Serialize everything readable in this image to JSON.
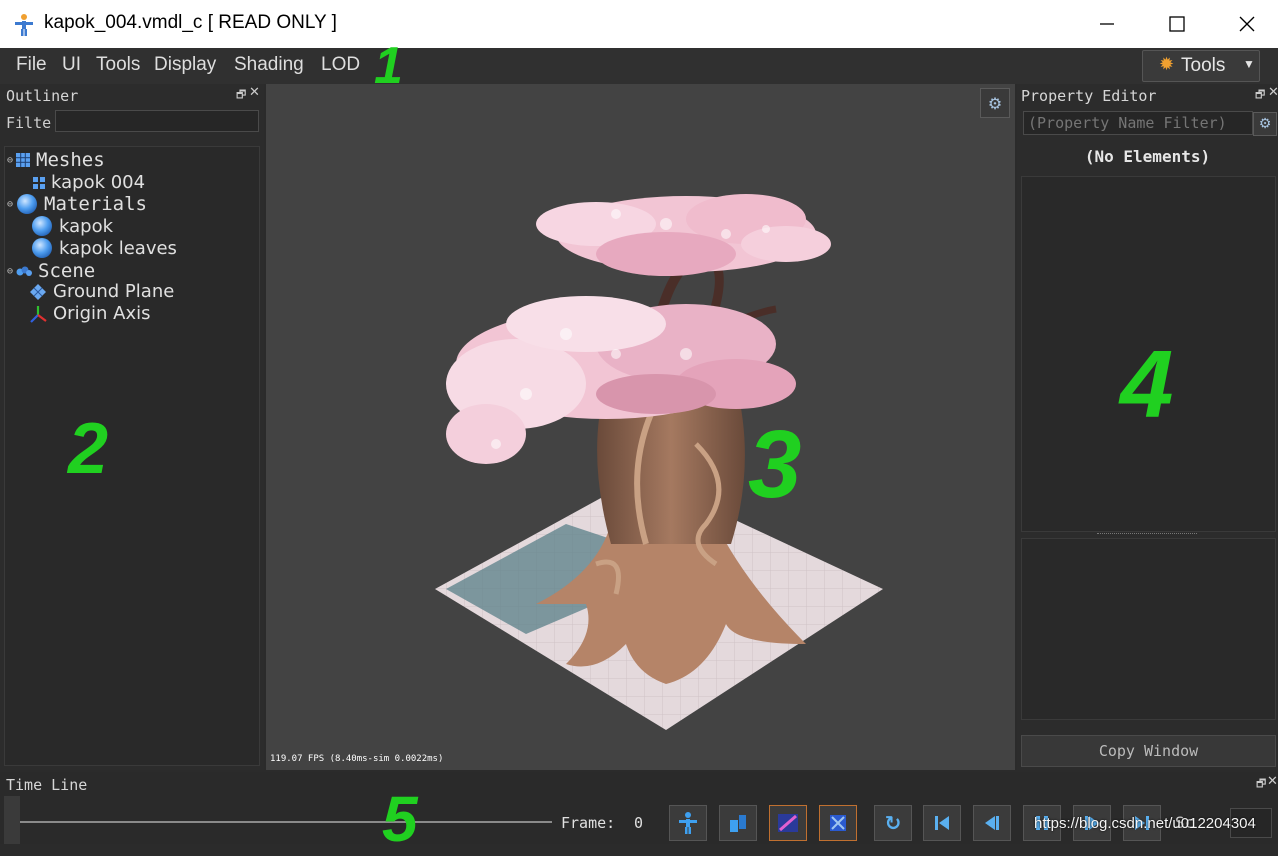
{
  "window": {
    "title": "kapok_004.vmdl_c [ READ ONLY ]",
    "minimize": "minimize-icon",
    "maximize": "maximize-icon",
    "close": "close-icon"
  },
  "menu": [
    "File",
    "UI",
    "Tools",
    "Display",
    "Shading",
    "LOD"
  ],
  "tools_button": {
    "label": "Tools",
    "icon": "gear-icon"
  },
  "outliner": {
    "title": "Outliner",
    "filter_label": "Filte",
    "filter_value": "",
    "tree": [
      {
        "label": "Meshes",
        "icon": "mesh-grid-icon",
        "children": [
          {
            "label": "kapok 004",
            "icon": "mesh-icon"
          }
        ]
      },
      {
        "label": "Materials",
        "icon": "material-sphere-icon",
        "children": [
          {
            "label": "kapok",
            "icon": "material-sphere-icon"
          },
          {
            "label": "kapok leaves",
            "icon": "material-sphere-icon"
          }
        ]
      },
      {
        "label": "Scene",
        "icon": "scene-icon",
        "children": [
          {
            "label": "Ground Plane",
            "icon": "ground-plane-icon"
          },
          {
            "label": "Origin Axis",
            "icon": "axis-icon"
          }
        ]
      }
    ]
  },
  "viewport": {
    "fps_text": "119.07 FPS (8.40ms-sim 0.0022ms)",
    "settings_icon": "gear-icon"
  },
  "property_editor": {
    "title": "Property Editor",
    "filter_placeholder": "(Property Name Filter)",
    "empty_text": "(No Elements)",
    "copy_button": "Copy Window"
  },
  "timeline": {
    "title": "Time Line",
    "frame_label": "Frame:",
    "frame_value": "0",
    "buttons": [
      "skeleton-icon",
      "bone-icon",
      "animation-icon",
      "physics-icon",
      "loop-icon",
      "first-frame-icon",
      "prev-frame-icon",
      "pause-icon",
      "play-icon",
      "last-frame-icon"
    ],
    "cut_text": "Sc"
  },
  "watermark": "https://blog.csdn.net/u012204304",
  "annotations": [
    "1",
    "2",
    "3",
    "4",
    "5"
  ]
}
